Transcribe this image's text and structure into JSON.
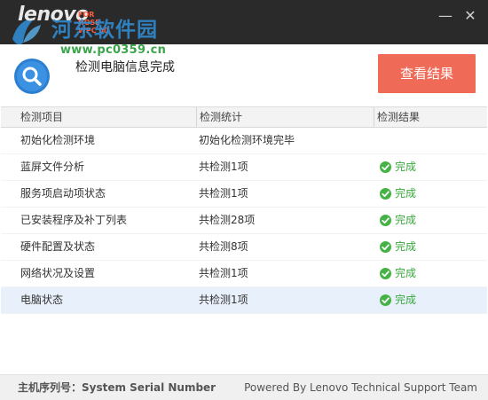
{
  "window": {
    "logo_text": "lenovo",
    "logo_sub": "FOR HOSE WPC 00",
    "watermark_title": "河东软件园",
    "watermark_url": "www.pc0359.cn",
    "minimize_glyph": "—",
    "close_glyph": "✕"
  },
  "header": {
    "status": "检测电脑信息完成",
    "result_button": "查看结果",
    "accent_color": "#f06a58"
  },
  "table": {
    "columns": [
      "检测项目",
      "检测统计",
      "检测结果"
    ],
    "rows": [
      {
        "item": "初始化检测环境",
        "stat": "初始化检测环境完毕",
        "result": ""
      },
      {
        "item": "蓝屏文件分析",
        "stat": "共检测1项",
        "result": "完成"
      },
      {
        "item": "服务项启动项状态",
        "stat": "共检测1项",
        "result": "完成"
      },
      {
        "item": "已安装程序及补丁列表",
        "stat": "共检测28项",
        "result": "完成"
      },
      {
        "item": "硬件配置及状态",
        "stat": "共检测8项",
        "result": "完成"
      },
      {
        "item": "网络状况及设置",
        "stat": "共检测1项",
        "result": "完成"
      },
      {
        "item": "电脑状态",
        "stat": "共检测1项",
        "result": "完成"
      }
    ],
    "selected_row_index": 6
  },
  "footer": {
    "serial": "主机序列号：System Serial Number",
    "powered": "Powered By Lenovo Technical Support Team"
  }
}
